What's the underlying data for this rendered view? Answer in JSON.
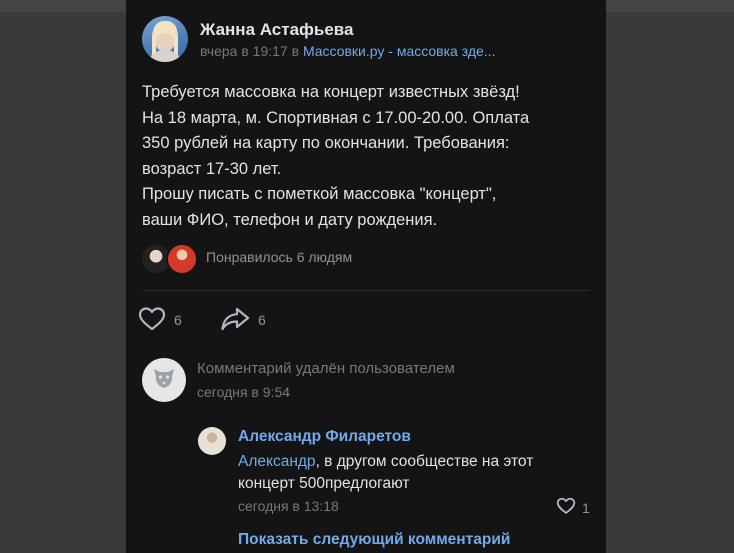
{
  "post": {
    "author": "Жанна Астафьева",
    "time": "вчера в 19:17",
    "in_word": " в ",
    "community": "Массовки.ру - массовка зде...",
    "text_lines": [
      "Требуется массовка на концерт известных звёзд!",
      "На 18 марта, м. Спортивная с 17.00-20.00. Оплата",
      "350 рублей на карту по окончании. Требования:",
      "возраст 17-30 лет.",
      "Прошу писать с пометкой массовка \"концерт\",",
      "ваши ФИО, телефон и дату рождения."
    ],
    "liked_by": "Понравилось 6 людям",
    "likes_count": "6",
    "shares_count": "6"
  },
  "comments": {
    "deleted": {
      "text": "Комментарий удалён пользователем",
      "time": "сегодня в 9:54"
    },
    "reply": {
      "author": "Александр Филаретов",
      "mention": "Александр",
      "text_rest": ", в другом сообществе на этот",
      "text_line2": "концерт 500предлогают",
      "time": "сегодня в 13:18",
      "likes": "1"
    },
    "show_next": "Показать следующий комментарий"
  },
  "colors": {
    "background": "#141414",
    "text": "#e1e3e6",
    "secondary": "#76787a",
    "link": "#71aaeb"
  },
  "icons": [
    "heart-icon",
    "share-icon",
    "deleted-user-dog-icon"
  ]
}
